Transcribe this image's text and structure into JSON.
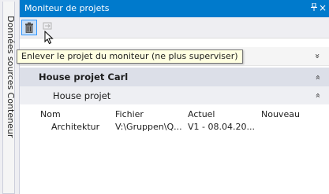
{
  "side_tab": {
    "label": "Données sources Conteneur"
  },
  "panel": {
    "title": "Moniteur de projets",
    "pin_glyph": "ᵩ",
    "close_glyph": "×"
  },
  "toolbar": {
    "remove_icon": "trash-icon",
    "add_icon": "monitor-add-icon"
  },
  "tooltip": {
    "text": "Enlever le projet du moniteur (ne plus superviser)"
  },
  "project": {
    "name": "House projet Carl",
    "sub": "House projet",
    "columns": [
      "Nom",
      "Fichier",
      "Actuel",
      "Nouveau"
    ],
    "rows": [
      {
        "nom": "Architektur",
        "fichier": "V:\\Gruppen\\Q...",
        "actuel": "V1 - 08.04.20...",
        "nouveau": ""
      }
    ]
  },
  "colors": {
    "accent": "#007acc",
    "project_header": "#dcdfe8",
    "sub_header": "#eeeff3",
    "tooltip_bg": "#ffffe1"
  }
}
